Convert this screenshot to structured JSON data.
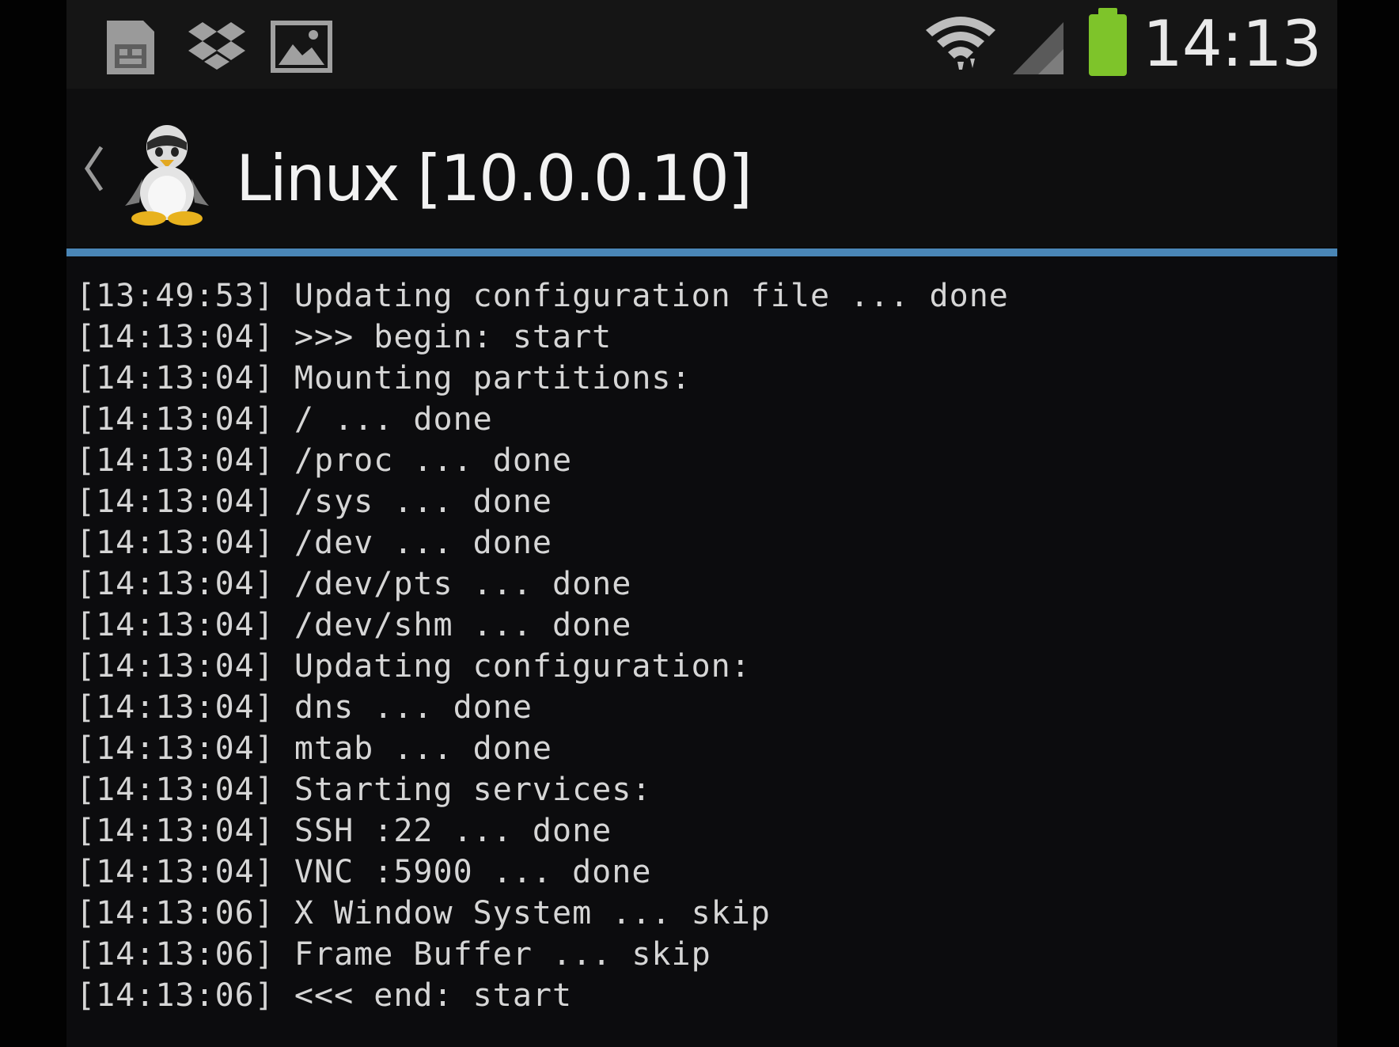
{
  "status_bar": {
    "notification_icons": [
      "sim-card-icon",
      "dropbox-icon",
      "gallery-icon"
    ],
    "wifi_icon": "wifi-icon",
    "signal_icon": "signal-icon",
    "battery_icon": "battery-icon",
    "battery_color": "#7ec42a",
    "clock": "14:13"
  },
  "action_bar": {
    "back_icon": "back-chevron-icon",
    "app_icon": "tux-penguin-icon",
    "title": "Linux [10.0.0.10]",
    "divider_color": "#4a86b6"
  },
  "console": {
    "lines": [
      {
        "time": "[13:49:53]",
        "message": "Updating configuration file ... done"
      },
      {
        "time": "[14:13:04]",
        "message": ">>> begin: start"
      },
      {
        "time": "[14:13:04]",
        "message": "Mounting partitions:"
      },
      {
        "time": "[14:13:04]",
        "message": "/ ... done"
      },
      {
        "time": "[14:13:04]",
        "message": "/proc ... done"
      },
      {
        "time": "[14:13:04]",
        "message": "/sys ... done"
      },
      {
        "time": "[14:13:04]",
        "message": "/dev ... done"
      },
      {
        "time": "[14:13:04]",
        "message": "/dev/pts ... done"
      },
      {
        "time": "[14:13:04]",
        "message": "/dev/shm ... done"
      },
      {
        "time": "[14:13:04]",
        "message": "Updating configuration:"
      },
      {
        "time": "[14:13:04]",
        "message": "dns ... done"
      },
      {
        "time": "[14:13:04]",
        "message": "mtab ... done"
      },
      {
        "time": "[14:13:04]",
        "message": "Starting services:"
      },
      {
        "time": "[14:13:04]",
        "message": "SSH :22 ... done"
      },
      {
        "time": "[14:13:04]",
        "message": "VNC :5900 ... done"
      },
      {
        "time": "[14:13:06]",
        "message": "X Window System ... skip"
      },
      {
        "time": "[14:13:06]",
        "message": "Frame Buffer ... skip"
      },
      {
        "time": "[14:13:06]",
        "message": "<<< end: start"
      }
    ]
  }
}
